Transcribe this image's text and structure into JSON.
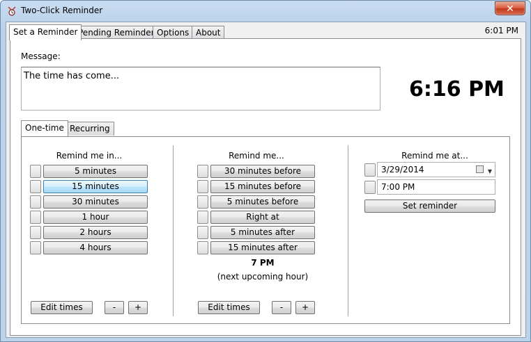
{
  "window": {
    "title": "Two-Click Reminder",
    "close_label": "✕"
  },
  "main_tabs": [
    "Set a Reminder",
    "Pending Reminders",
    "Options",
    "About"
  ],
  "clock_small": "6:01 PM",
  "message": {
    "label": "Message:",
    "value": "The time has come..."
  },
  "big_clock": "6:16 PM",
  "sub_tabs": [
    "One-time",
    "Recurring"
  ],
  "remind_in": {
    "title": "Remind me in...",
    "options": [
      "5 minutes",
      "15 minutes",
      "30 minutes",
      "1 hour",
      "2 hours",
      "4 hours"
    ],
    "edit_label": "Edit times",
    "minus_label": "-",
    "plus_label": "+"
  },
  "remind_relative": {
    "title": "Remind me...",
    "options": [
      "30 minutes before",
      "15 minutes before",
      "5 minutes before",
      "Right at",
      "5 minutes after",
      "15 minutes after"
    ],
    "hour": "7 PM",
    "hour_note": "(next upcoming hour)",
    "edit_label": "Edit times",
    "minus_label": "-",
    "plus_label": "+"
  },
  "remind_at": {
    "title": "Remind me at...",
    "date": "3/29/2014",
    "time": "7:00 PM",
    "set_label": "Set reminder"
  },
  "colors": {
    "hover_accent": "#bee6fd",
    "titlebar": "#b9d1ea",
    "close": "#c23a1c"
  },
  "icons": [
    "app-reminder-icon",
    "close-icon",
    "calendar-icon",
    "dropdown-arrow-icon"
  ]
}
